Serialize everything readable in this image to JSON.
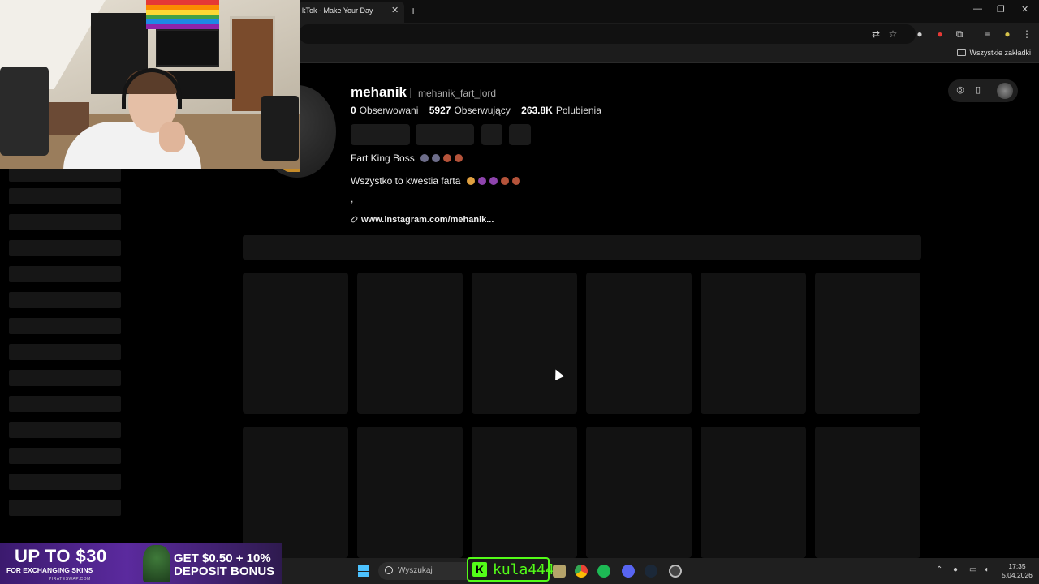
{
  "browser": {
    "tab_title": "kTok - Make Your Day",
    "tab_close": "✕",
    "new_tab": "+",
    "window_controls": [
      "—",
      "❐",
      "✕"
    ],
    "toolbar_icons": [
      "translate-icon",
      "star-icon",
      "mic-icon",
      "extension-icon",
      "puzzle-icon",
      "media-icon",
      "profile-icon",
      "menu-icon"
    ],
    "bookmarks_all": "Wszystkie zakładki"
  },
  "profile": {
    "username": "mehanik",
    "handle": "mehanik_fart_lord",
    "stats": [
      {
        "value": "0",
        "label": "Obserwowani"
      },
      {
        "value": "5927",
        "label": "Obserwujący"
      },
      {
        "value": "263.8K",
        "label": "Polubienia"
      }
    ],
    "bio_line1": "Fart King Boss",
    "bio_line2": "Wszystko to kwestia farta",
    "bio_line3": ",",
    "link": "www.instagram.com/mehanik..."
  },
  "banner": {
    "line1": "UP TO $30",
    "line2": "FOR EXCHANGING SKINS",
    "line3": "PIRATESWAP.COM",
    "right1": "GET $0.50 + 10%",
    "right2": "DEPOSIT BONUS"
  },
  "taskbar": {
    "search_placeholder": "Wyszukaj",
    "kick_logo": "K",
    "kick_name": "kula444",
    "time": "17:35",
    "date": "5.04.2026"
  }
}
